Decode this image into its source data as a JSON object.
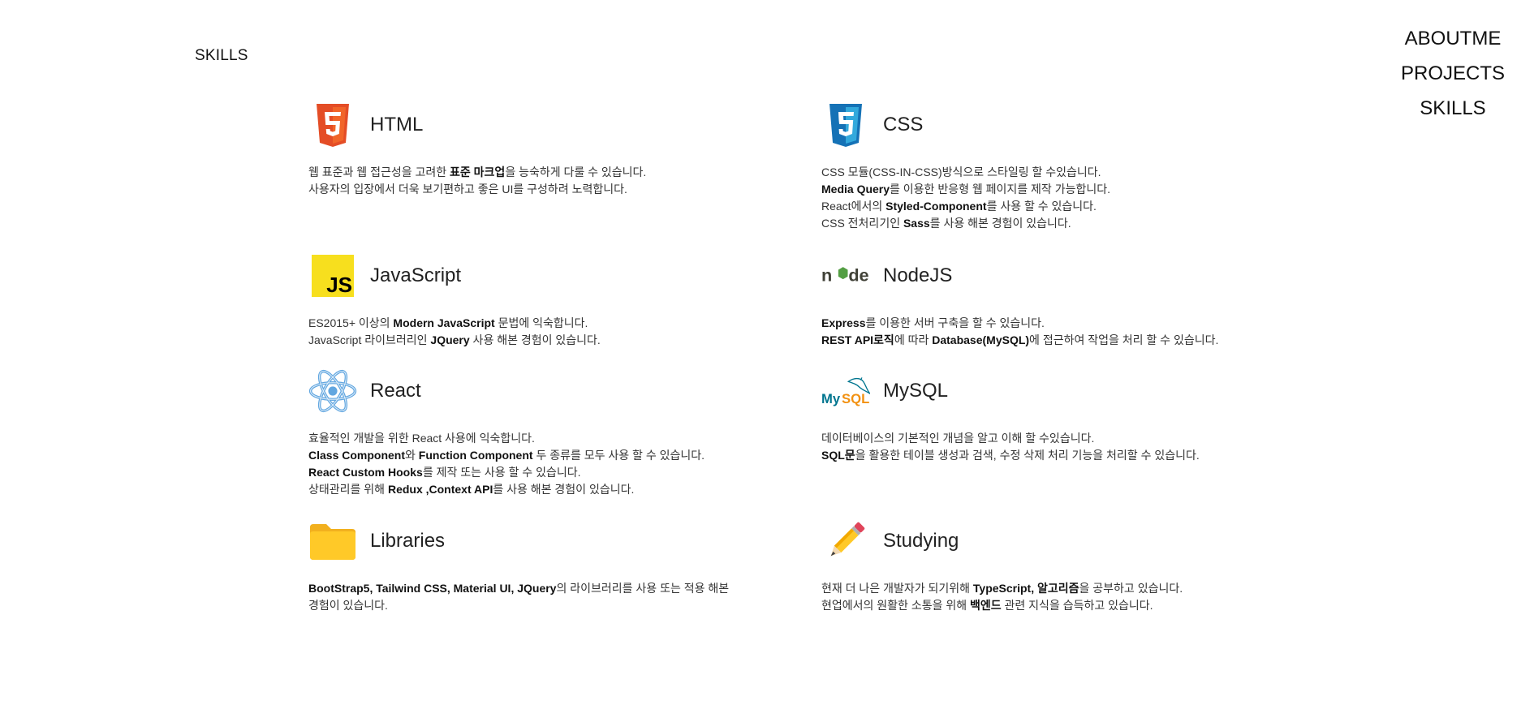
{
  "page": {
    "section_title": "SKILLS"
  },
  "nav": {
    "items": [
      "ABOUTME",
      "PROJECTS",
      "SKILLS"
    ]
  },
  "skills": [
    {
      "name": "HTML",
      "icon": "html5-icon",
      "lines": [
        [
          {
            "t": "웹 표준과 웹 접근성을 고려한 "
          },
          {
            "t": "표준 마크업",
            "b": true
          },
          {
            "t": "을 능숙하게 다룰 수 있습니다."
          }
        ],
        [
          {
            "t": "사용자의 입장에서 더욱 보기편하고 좋은 UI를 구성하려 노력합니다."
          }
        ]
      ]
    },
    {
      "name": "CSS",
      "icon": "css3-icon",
      "lines": [
        [
          {
            "t": "CSS 모듈(CSS-IN-CSS)방식으로 스타일링 할 수있습니다."
          }
        ],
        [
          {
            "t": "Media Query",
            "b": true
          },
          {
            "t": "를 이용한 반응형 웹 페이지를 제작 가능합니다."
          }
        ],
        [
          {
            "t": "React에서의 "
          },
          {
            "t": "Styled-Component",
            "b": true
          },
          {
            "t": "를 사용 할 수 있습니다."
          }
        ],
        [
          {
            "t": "CSS 전처리기인 "
          },
          {
            "t": "Sass",
            "b": true
          },
          {
            "t": "를 사용 해본 경험이 있습니다."
          }
        ]
      ]
    },
    {
      "name": "JavaScript",
      "icon": "javascript-icon",
      "lines": [
        [
          {
            "t": "ES2015+ 이상의 "
          },
          {
            "t": "Modern JavaScript",
            "b": true
          },
          {
            "t": " 문법에 익숙합니다."
          }
        ],
        [
          {
            "t": "JavaScript 라이브러리인 "
          },
          {
            "t": "JQuery",
            "b": true
          },
          {
            "t": " 사용 해본 경험이 있습니다."
          }
        ]
      ]
    },
    {
      "name": "NodeJS",
      "icon": "nodejs-icon",
      "lines": [
        [
          {
            "t": "Express",
            "b": true
          },
          {
            "t": "를 이용한 서버 구축을 할 수 있습니다."
          }
        ],
        [
          {
            "t": "REST API로직",
            "b": true
          },
          {
            "t": "에 따라 "
          },
          {
            "t": "Database(MySQL)",
            "b": true
          },
          {
            "t": "에 접근하여 작업을 처리 할 수 있습니다."
          }
        ]
      ]
    },
    {
      "name": "React",
      "icon": "react-icon",
      "lines": [
        [
          {
            "t": "효율적인 개발을 위한 React 사용에 익숙합니다."
          }
        ],
        [
          {
            "t": "Class Component",
            "b": true
          },
          {
            "t": "와 "
          },
          {
            "t": "Function Component",
            "b": true
          },
          {
            "t": " 두 종류를 모두 사용 할 수 있습니다."
          }
        ],
        [
          {
            "t": "React Custom Hooks",
            "b": true
          },
          {
            "t": "를 제작 또는 사용 할 수 있습니다."
          }
        ],
        [
          {
            "t": "상태관리를 위해 "
          },
          {
            "t": "Redux ,Context API",
            "b": true
          },
          {
            "t": "를 사용 해본 경험이 있습니다."
          }
        ]
      ]
    },
    {
      "name": "MySQL",
      "icon": "mysql-icon",
      "lines": [
        [
          {
            "t": "데이터베이스의 기본적인 개념을 알고 이해 할 수있습니다."
          }
        ],
        [
          {
            "t": "SQL문",
            "b": true
          },
          {
            "t": "을 활용한 테이블 생성과 검색, 수정 삭제 처리 기능을 처리할 수 있습니다."
          }
        ]
      ]
    },
    {
      "name": "Libraries",
      "icon": "folder-icon",
      "lines": [
        [
          {
            "t": "BootStrap5, Tailwind CSS, Material UI, JQuery",
            "b": true
          },
          {
            "t": "의 라이브러리를 사용 또는 적용 해본 경험이 있습니다."
          }
        ]
      ],
      "wrap": true
    },
    {
      "name": "Studying",
      "icon": "pencil-icon",
      "lines": [
        [
          {
            "t": "현재 더 나은 개발자가 되기위해 "
          },
          {
            "t": "TypeScript, 알고리즘",
            "b": true
          },
          {
            "t": "을 공부하고 있습니다."
          }
        ],
        [
          {
            "t": "현업에서의 원활한 소통을 위해 "
          },
          {
            "t": "백엔드",
            "b": true
          },
          {
            "t": " 관련 지식을 습득하고 있습니다."
          }
        ]
      ]
    }
  ],
  "colors": {
    "html5": "#e44d26",
    "css3": "#1572b6",
    "js_bg": "#f7df1e",
    "node_green": "#539e43",
    "react_blue": "#61a6e0",
    "mysql_blue": "#00758f",
    "mysql_orange": "#f29111",
    "folder": "#ffc928"
  }
}
